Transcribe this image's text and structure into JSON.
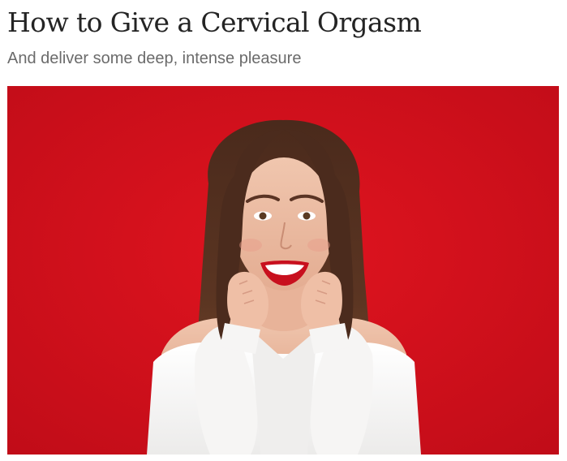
{
  "article": {
    "title": "How to Give a Cervical Orgasm",
    "subtitle": "And deliver some deep, intense pleasure"
  },
  "hero_image": {
    "subject": "smiling woman with long brown hair in white off-shoulder top resting chin on hands",
    "background_color": "#d1101e"
  }
}
